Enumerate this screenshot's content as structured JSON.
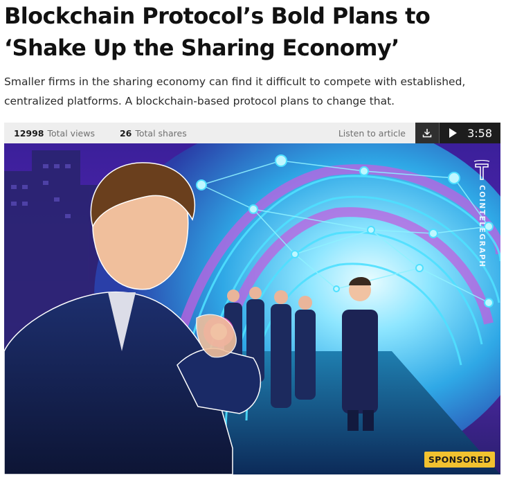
{
  "article": {
    "title": "Blockchain Protocol’s Bold Plans to ‘Shake Up the Sharing Economy’",
    "lead": "Smaller firms in the sharing economy can find it difficult to compete with established, centralized platforms. A blockchain-based protocol plans to change that."
  },
  "stats": {
    "views_value": "12998",
    "views_label": "Total views",
    "shares_value": "26",
    "shares_label": "Total shares",
    "listen_label": "Listen to article",
    "duration": "3:58"
  },
  "hero": {
    "brand": "COINTELEGRAPH",
    "badge": "SPONSORED"
  },
  "colors": {
    "badge": "#f2c230",
    "player_bg": "#1d1d1d",
    "stats_bg": "#eeeeee",
    "tunnel_glow": "#4fe0ff",
    "tunnel_purple": "#b04ad0"
  },
  "icons": [
    "download-icon",
    "play-icon",
    "cointelegraph-logo-icon"
  ]
}
